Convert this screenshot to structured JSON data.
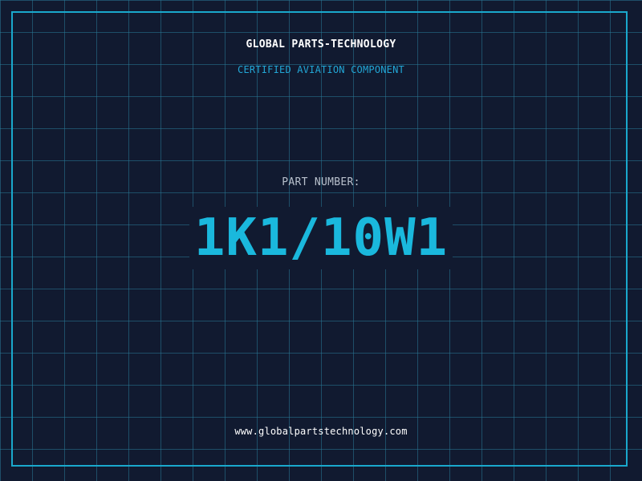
{
  "header": {
    "company": "GLOBAL PARTS-TECHNOLOGY",
    "subtitle": "CERTIFIED AVIATION COMPONENT"
  },
  "part": {
    "label": "PART NUMBER:",
    "number": "1K1/10W1"
  },
  "footer": {
    "url": "www.globalpartstechnology.com"
  },
  "colors": {
    "background": "#111a30",
    "grid": "#28789a",
    "frame": "#1aa8cc",
    "accent": "#1ab8dd"
  }
}
